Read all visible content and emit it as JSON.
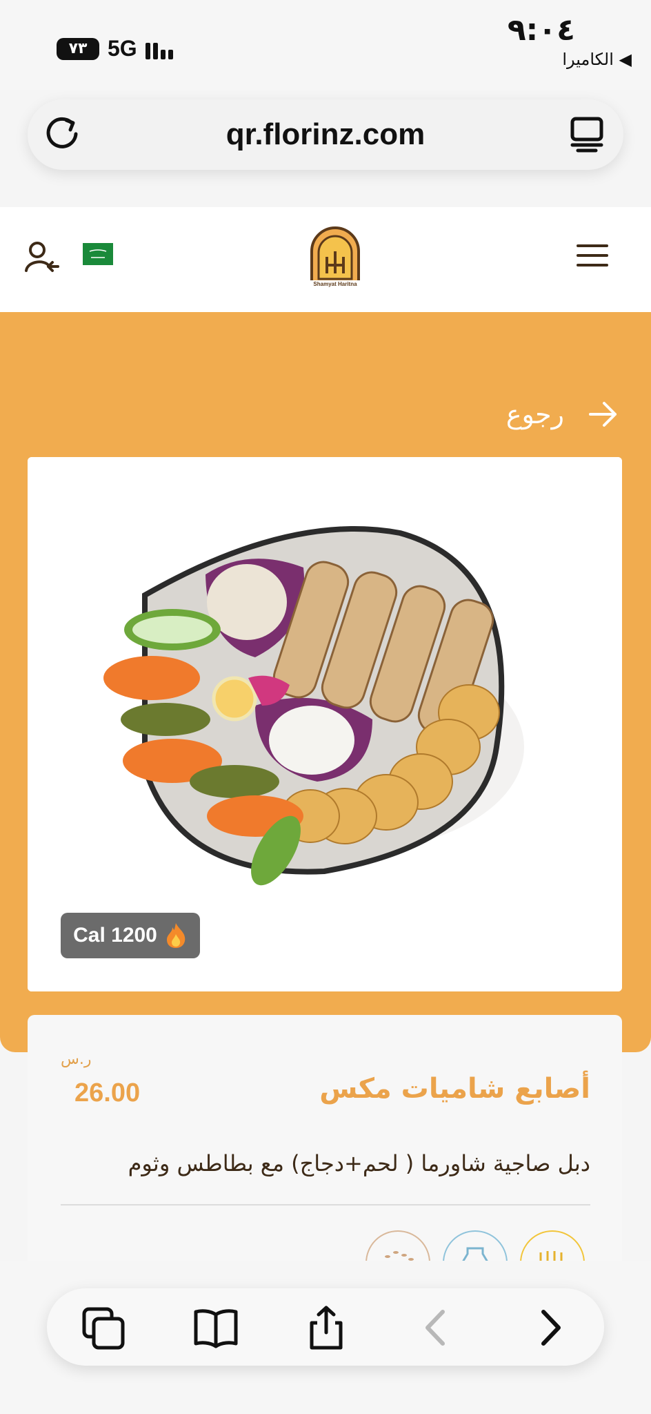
{
  "status_bar": {
    "time": "٩:٠٤",
    "back_label": "◀ الكاميرا",
    "network": "5G",
    "battery": "٧٣"
  },
  "browser": {
    "url": "qr.florinz.com"
  },
  "header": {
    "logo_text": "Shamyat Haritna"
  },
  "nav": {
    "back_label": "رجوع"
  },
  "product": {
    "calories": "Cal 1200",
    "currency": "ر.س",
    "price": "26.00",
    "title": "أصابع شاميات مكس",
    "description": "دبل صاجية شاورما ( لحم+دجاج) مع بطاطس وثوم"
  },
  "icons": {
    "reload": "reload-icon",
    "tabs": "tabs-icon",
    "menu": "hamburger-menu-icon",
    "user": "user-logout-icon",
    "flag": "saudi-flag-icon",
    "arrow": "arrow-right-icon",
    "fire": "fire-icon",
    "copy": "copy-tabs-icon",
    "bookmarks": "book-icon",
    "share": "share-icon",
    "back": "chevron-left-icon",
    "forward": "chevron-right-icon",
    "allergens": [
      "sesame-icon",
      "milk-icon",
      "gluten-icon"
    ]
  },
  "colors": {
    "accent": "#f1ac4f",
    "price": "#eba34b",
    "text_dark": "#3d2a17",
    "badge": "#6b6b6b"
  }
}
